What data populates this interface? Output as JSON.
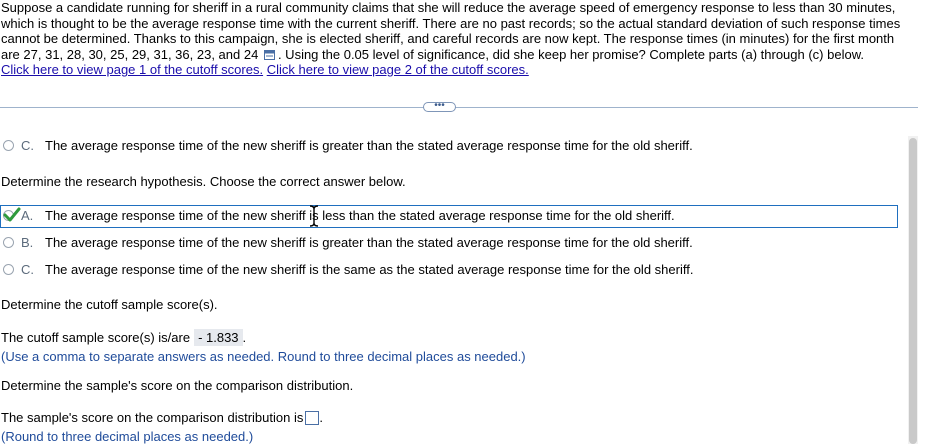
{
  "problem": {
    "text_before_icon": "Suppose a candidate running for sheriff in a rural community claims that she will reduce the average speed of emergency response to less than 30 minutes, which is thought to be the average response time with the current sheriff. There are no past records; so the actual standard deviation of such response times cannot be determined. Thanks to this campaign, she is elected sheriff, and careful records are now kept. The response times (in minutes) for the first month are 27, 31, 28, 30, 25, 29, 31, 36, 23, and 24",
    "text_after_icon": ". Using the 0.05 level of significance, did she keep her promise? Complete parts (a) through (c) below.",
    "link1": "Click here to view page 1 of the cutoff scores.",
    "link2": "Click here to view page 2 of the cutoff scores."
  },
  "more_button": "•••",
  "previous_option": {
    "letter": "C.",
    "text": "The average response time of the new sheriff is greater than the stated average response time for the old sheriff."
  },
  "research_hypothesis": {
    "prompt": "Determine the research hypothesis. Choose the correct answer below.",
    "options": [
      {
        "letter": "A.",
        "text": "The average response time of the new sheriff is less than the stated average response time for the old sheriff."
      },
      {
        "letter": "B.",
        "text": "The average response time of the new sheriff is greater than the stated average response time for the old sheriff."
      },
      {
        "letter": "C.",
        "text": "The average response time of the new sheriff is the same as the stated average response time for the old sheriff."
      }
    ]
  },
  "cutoff": {
    "prompt": "Determine the cutoff sample score(s).",
    "label": "The cutoff sample score(s) is/are",
    "value": "- 1.833",
    "period": ".",
    "note": "(Use a comma to separate answers as needed. Round to three decimal places as needed.)"
  },
  "sample_score": {
    "prompt": "Determine the sample's score on the comparison distribution.",
    "label": "The sample's score on the comparison distribution is",
    "period": ".",
    "note": "(Round to three decimal places as needed.)"
  },
  "colors": {
    "link": "#1a0dab",
    "selected_border": "#1f6fbf",
    "check": "#2e9a3c",
    "note": "#1f4b9a"
  }
}
